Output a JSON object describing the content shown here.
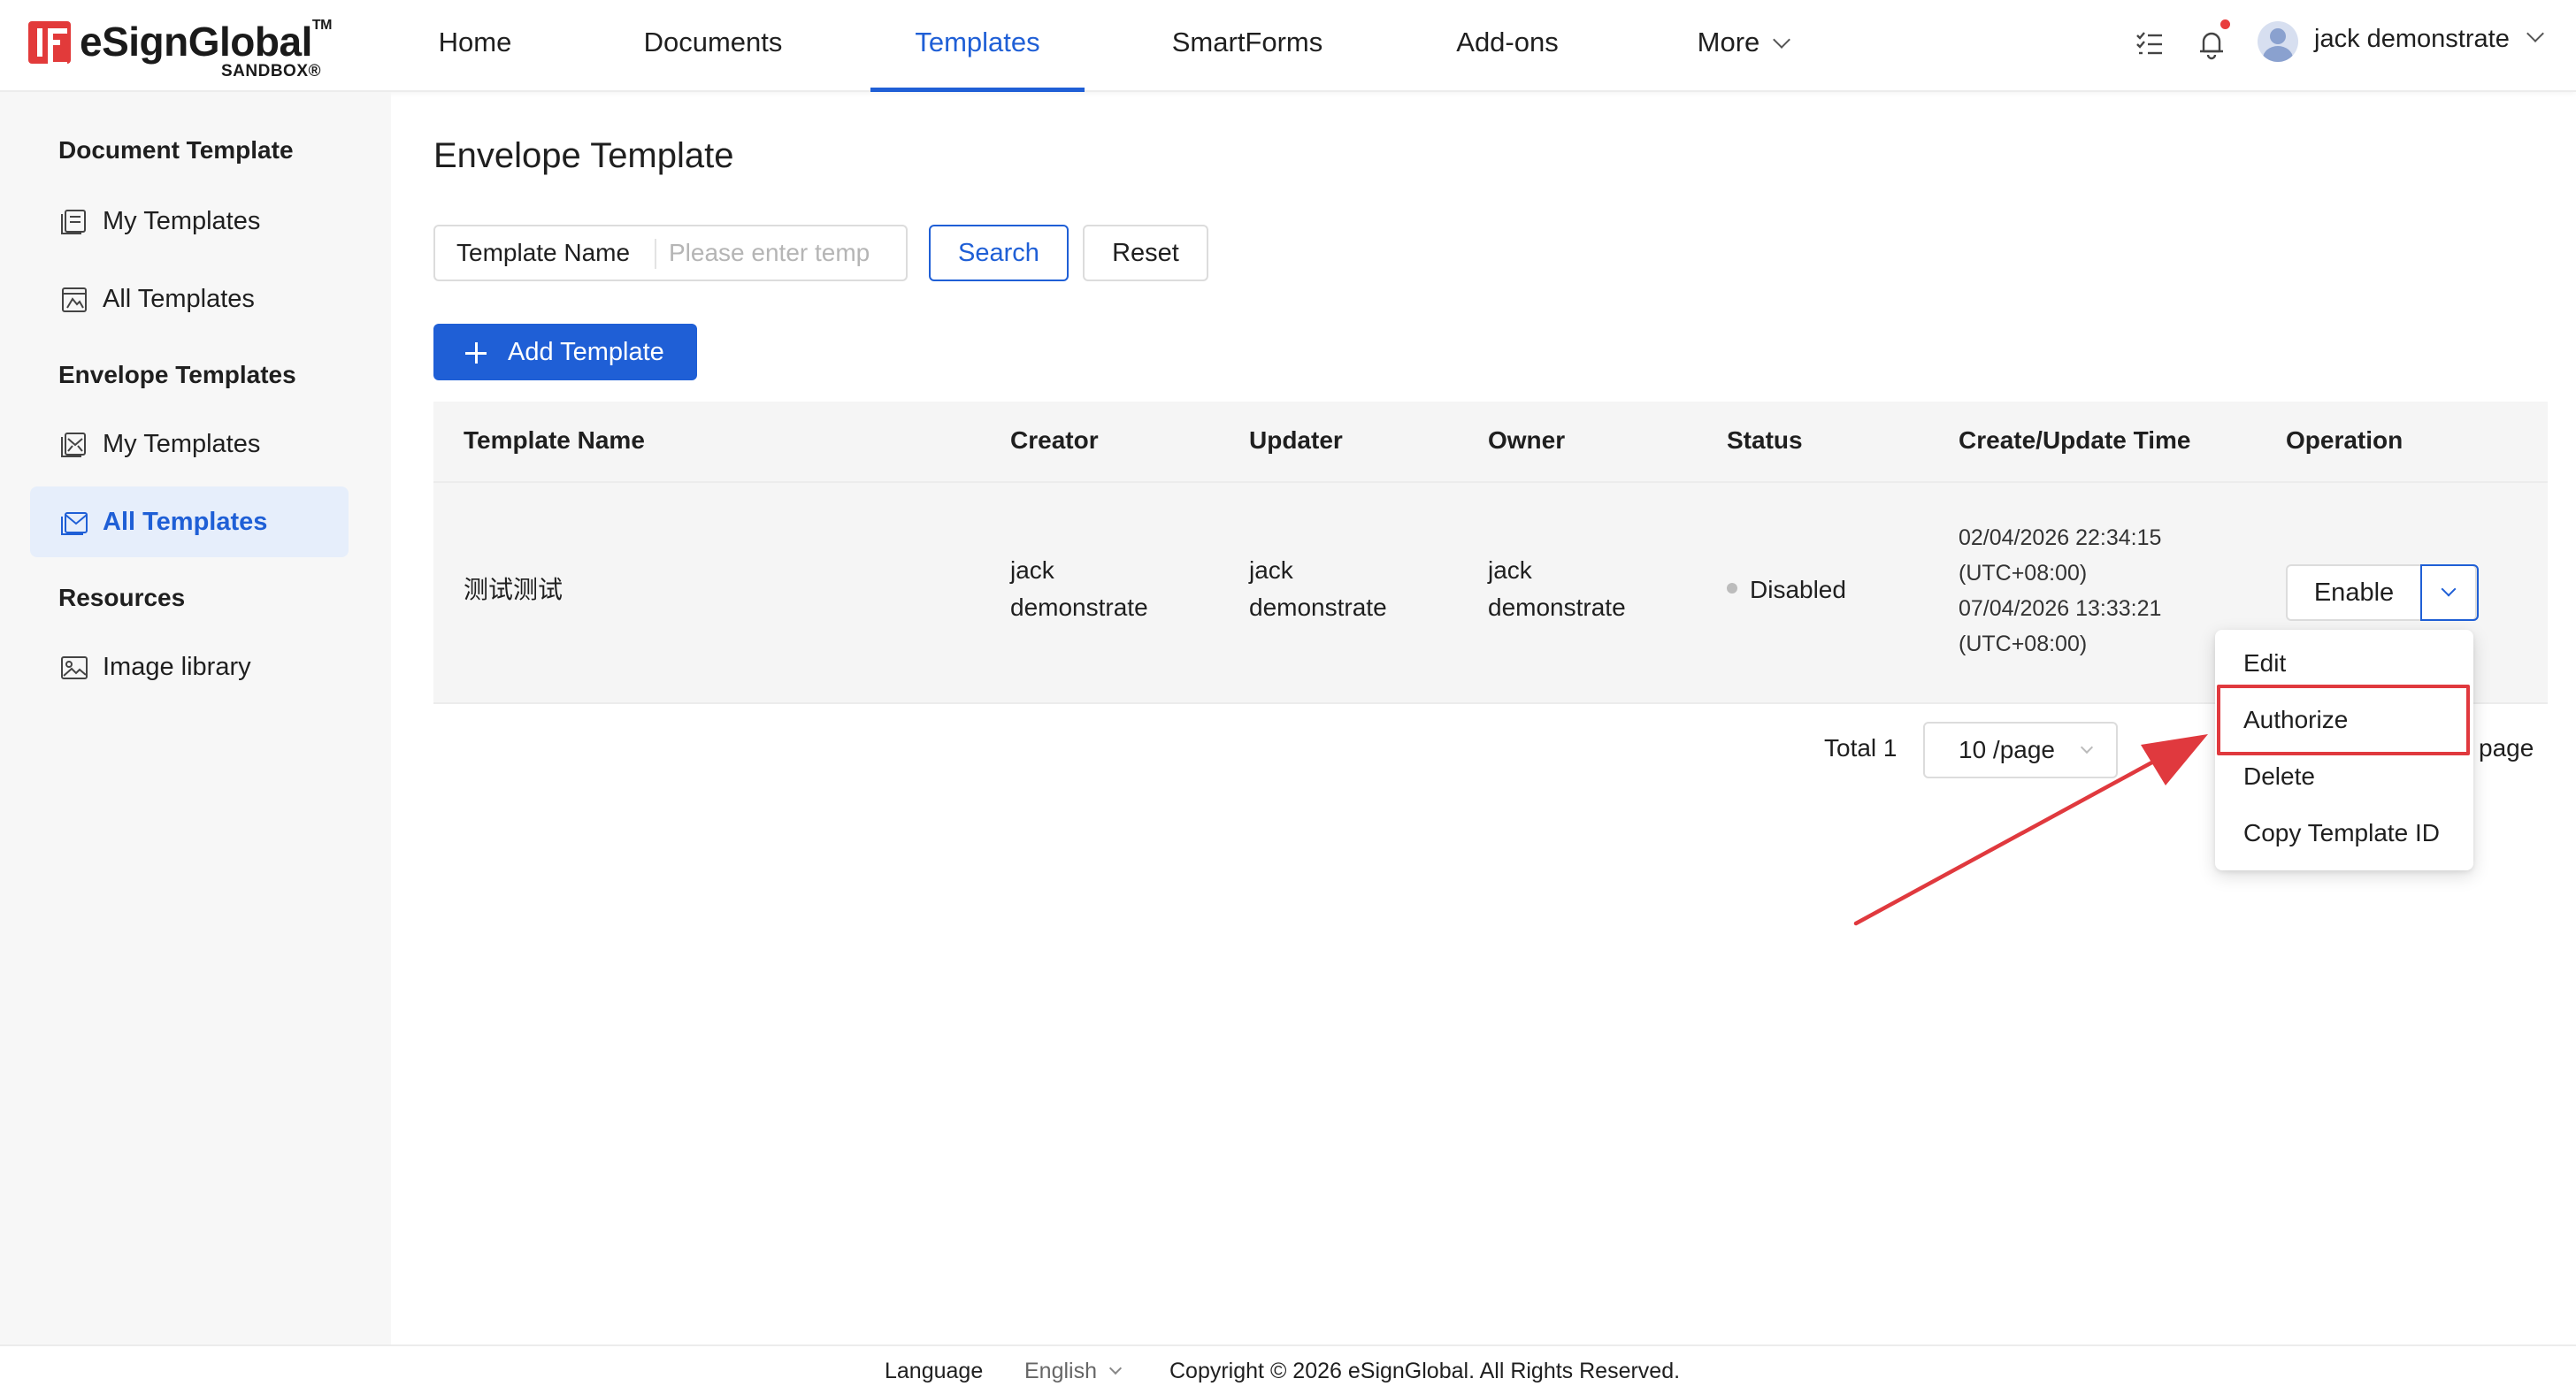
{
  "brand": {
    "name": "eSignGlobal",
    "tm": "TM",
    "env": "SANDBOX",
    "accent_color": "#1f5fd6",
    "logo_color": "#e23a3a"
  },
  "nav": {
    "items": [
      {
        "label": "Home",
        "active": false
      },
      {
        "label": "Documents",
        "active": false
      },
      {
        "label": "Templates",
        "active": true
      },
      {
        "label": "SmartForms",
        "active": false
      },
      {
        "label": "Add-ons",
        "active": false
      },
      {
        "label": "More",
        "active": false
      }
    ],
    "user_name": "jack demonstrate",
    "icons": [
      "task-list-icon",
      "bell-icon",
      "avatar-icon",
      "chevron-down-icon"
    ]
  },
  "sidebar": {
    "groups": [
      {
        "title": "Document Template",
        "items": [
          {
            "label": "My Templates",
            "icon": "document-stack-icon",
            "active": false
          },
          {
            "label": "All Templates",
            "icon": "document-grid-icon",
            "active": false
          }
        ]
      },
      {
        "title": "Envelope Templates",
        "items": [
          {
            "label": "My Templates",
            "icon": "envelope-stack-icon",
            "active": false
          },
          {
            "label": "All Templates",
            "icon": "envelope-grid-icon",
            "active": true
          }
        ]
      },
      {
        "title": "Resources",
        "items": [
          {
            "label": "Image library",
            "icon": "image-icon",
            "active": false
          }
        ]
      }
    ]
  },
  "main": {
    "title": "Envelope Template",
    "filter": {
      "label": "Template Name",
      "placeholder": "Please enter temp",
      "value": ""
    },
    "search_label": "Search",
    "reset_label": "Reset",
    "add_label": "Add Template",
    "table": {
      "columns": [
        "Template Name",
        "Creator",
        "Updater",
        "Owner",
        "Status",
        "Create/Update Time",
        "Operation"
      ],
      "rows": [
        {
          "name": "测试测试",
          "creator": [
            "jack",
            "demonstrate"
          ],
          "updater": [
            "jack",
            "demonstrate"
          ],
          "owner": [
            "jack",
            "demonstrate"
          ],
          "status": "Disabled",
          "times": [
            "02/04/2026 22:34:15",
            "(UTC+08:00)",
            "07/04/2026 13:33:21",
            "(UTC+08:00)"
          ],
          "operation": "Enable"
        }
      ]
    },
    "pagination": {
      "total": "Total 1",
      "page_size": "10 /page",
      "goto_suffix": "page"
    },
    "dropdown_menu": [
      "Edit",
      "Authorize",
      "Delete",
      "Copy Template ID"
    ],
    "highlighted_menu_item": "Authorize",
    "annotation_color": "#e0393e"
  },
  "footer": {
    "language_label": "Language",
    "language_value": "English",
    "copyright": "Copyright © 2026 eSignGlobal. All Rights Reserved."
  }
}
